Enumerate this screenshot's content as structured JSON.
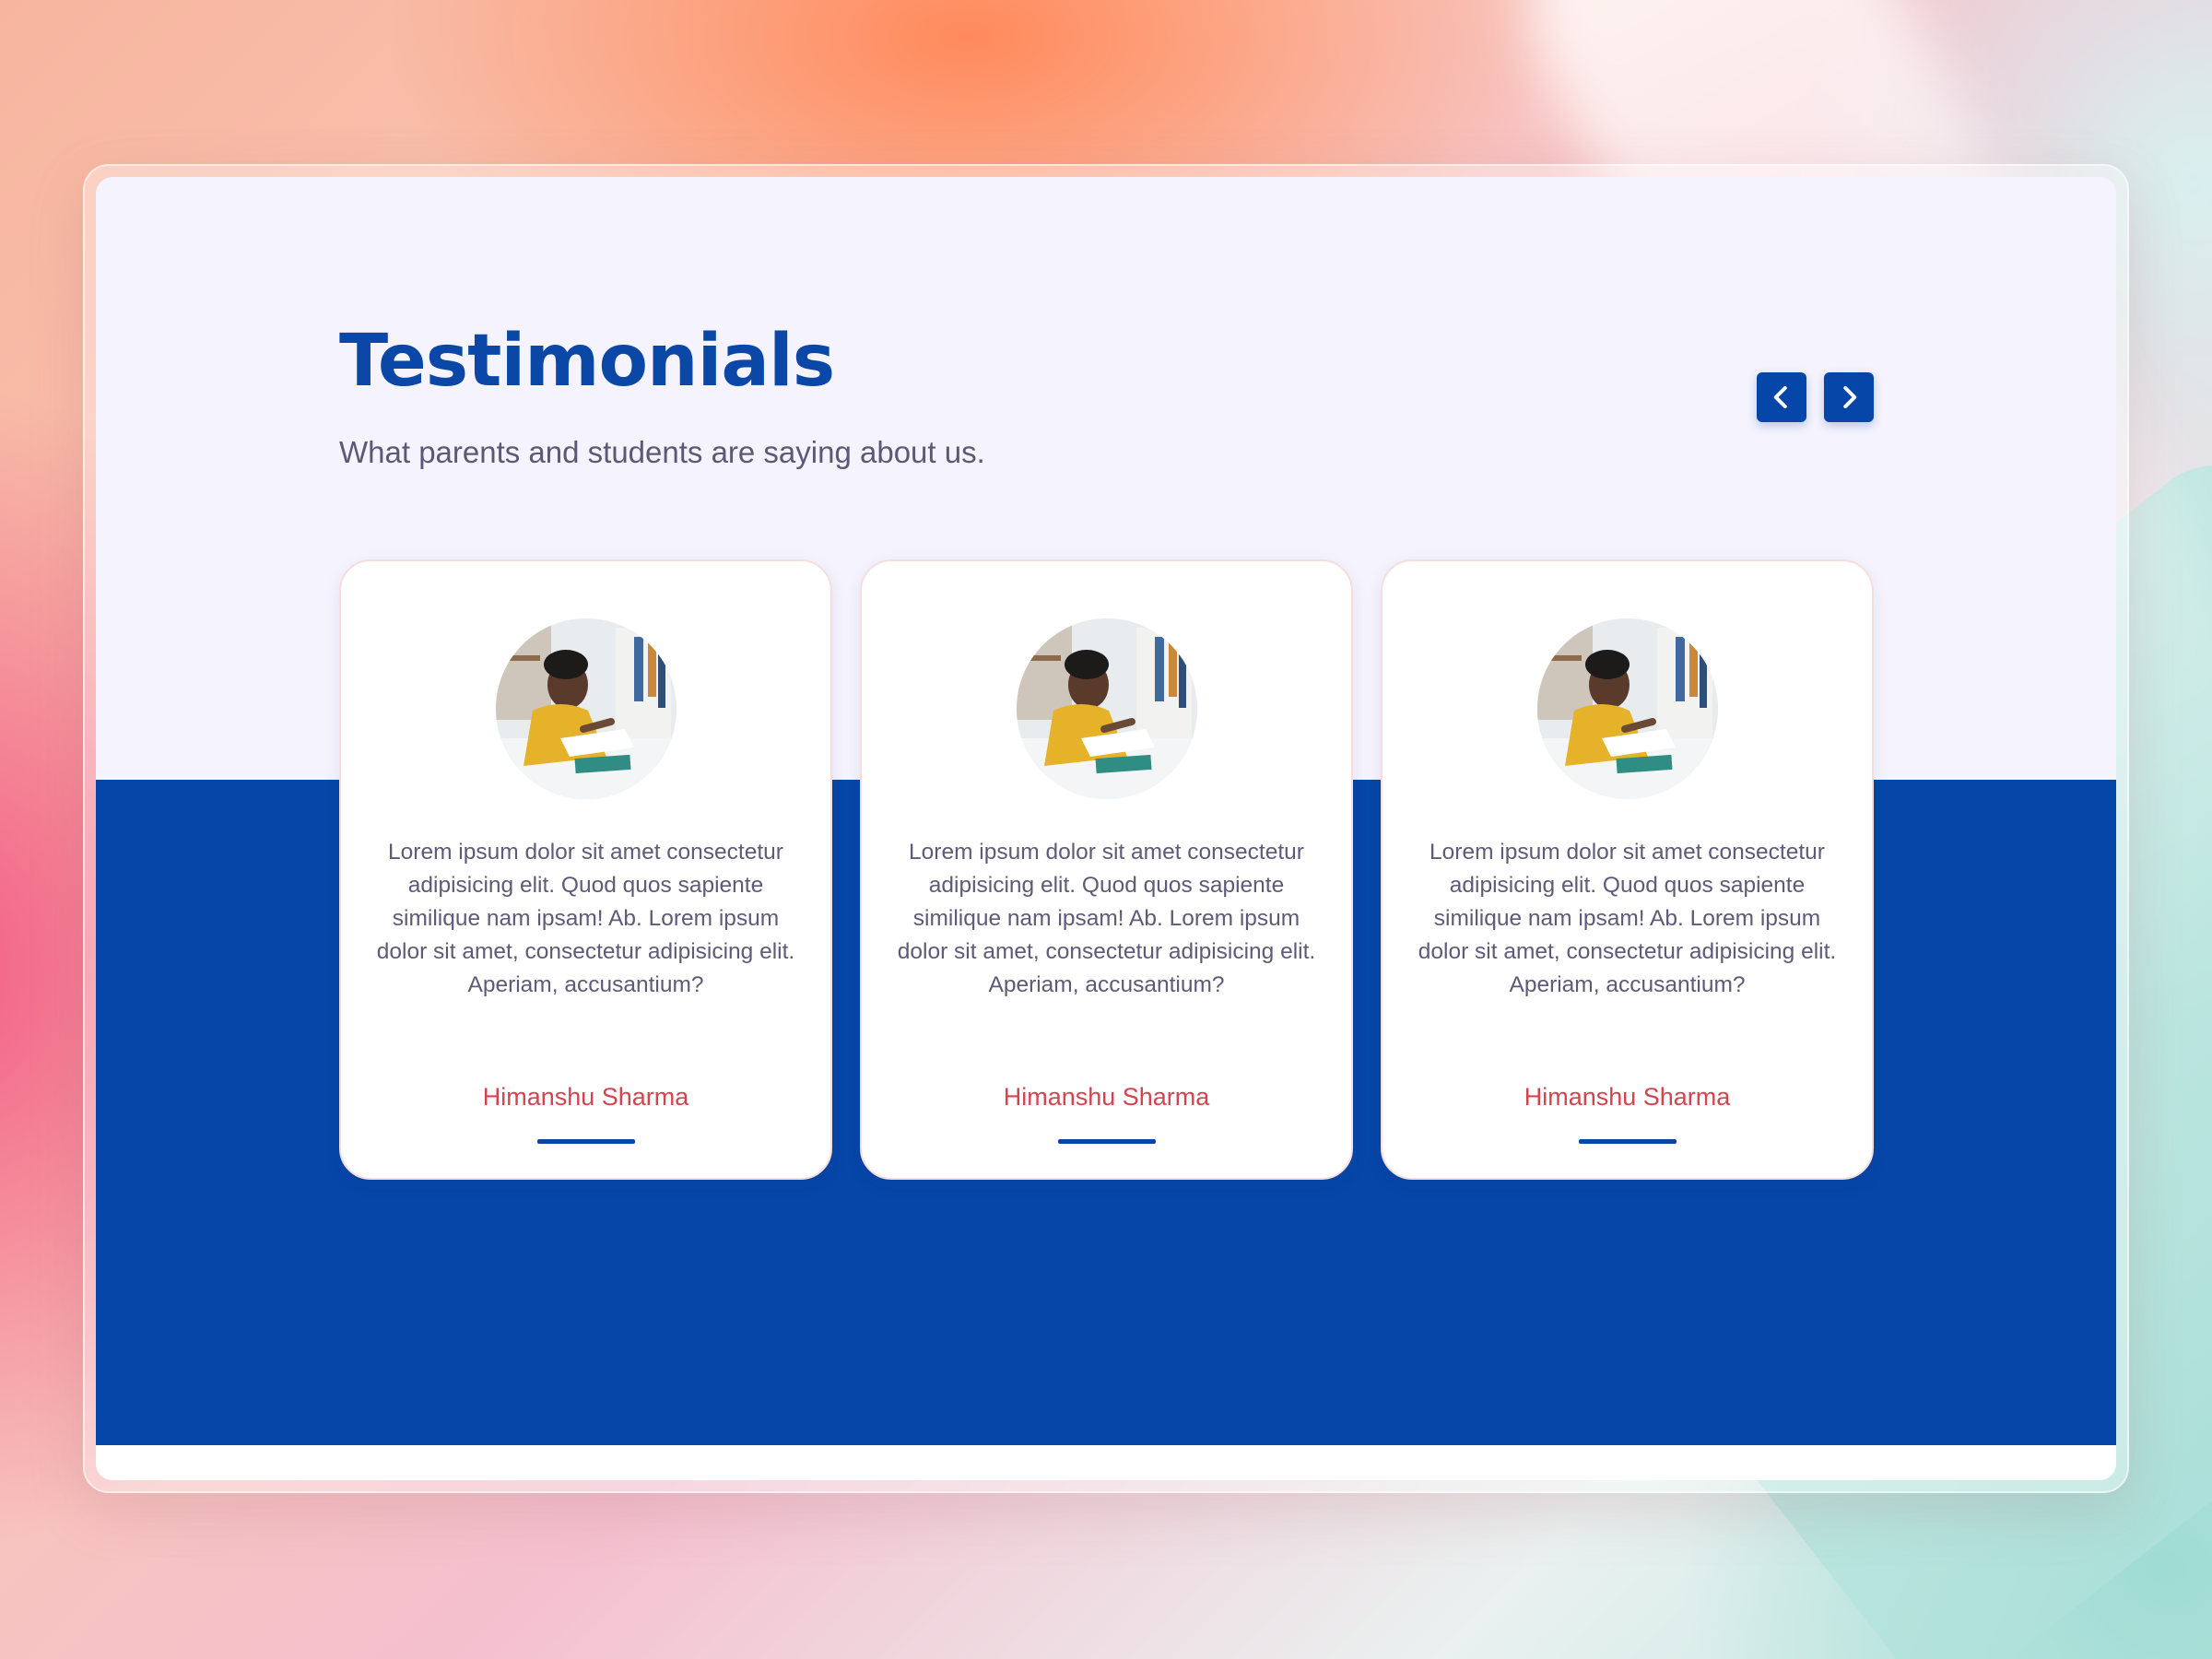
{
  "section": {
    "title": "Testimonials",
    "subtitle": "What parents and students are saying about us."
  },
  "nav": {
    "prev_icon": "chevron-left-icon",
    "next_icon": "chevron-right-icon"
  },
  "testimonials": [
    {
      "quote": "Lorem ipsum dolor sit amet consectetur adipisicing elit. Quod quos sapiente similique nam ipsam! Ab. Lorem ipsum dolor sit amet, consectetur adipisicing elit. Aperiam, accusantium?",
      "author": "Himanshu Sharma"
    },
    {
      "quote": "Lorem ipsum dolor sit amet consectetur adipisicing elit. Quod quos sapiente similique nam ipsam! Ab. Lorem ipsum dolor sit amet, consectetur adipisicing elit. Aperiam, accusantium?",
      "author": "Himanshu Sharma"
    },
    {
      "quote": "Lorem ipsum dolor sit amet consectetur adipisicing elit. Quod quos sapiente similique nam ipsam! Ab. Lorem ipsum dolor sit amet, consectetur adipisicing elit. Aperiam, accusantium?",
      "author": "Himanshu Sharma"
    }
  ],
  "colors": {
    "primary_blue": "#0646a8",
    "author_red": "#d2454f",
    "panel_bg": "#f5f3fd",
    "text_muted": "#5f5a78"
  }
}
